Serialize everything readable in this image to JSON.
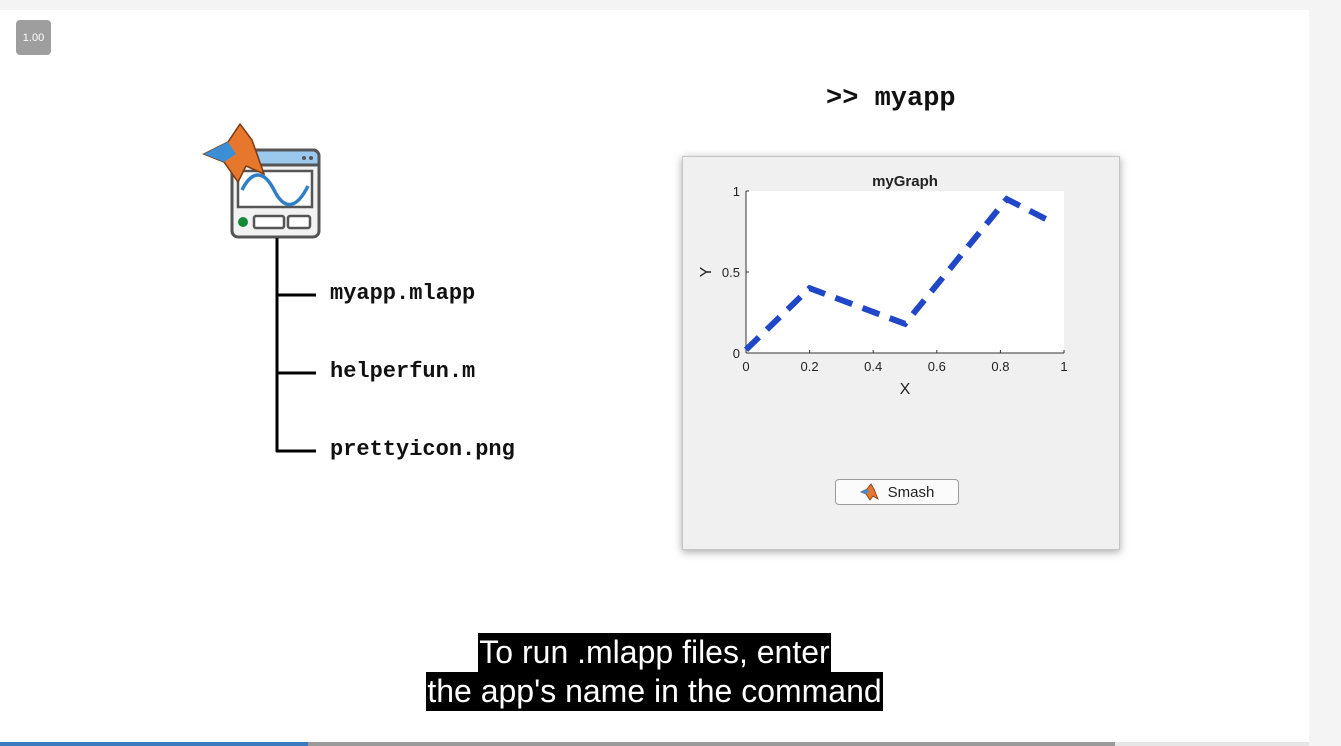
{
  "player": {
    "speed_label": "1.00",
    "progress_fraction": 0.235,
    "buffered_fraction": 0.852
  },
  "slide": {
    "command": ">> myapp",
    "files": [
      "myapp.mlapp",
      "helperfun.m",
      "prettyicon.png"
    ],
    "icons": {
      "app": "matlab-app-icon",
      "button": "matlab-logo-icon"
    },
    "colors": {
      "line": "#1f47c8",
      "matlab_orange": "#e8772e",
      "matlab_blue": "#3c8fd6"
    }
  },
  "figure": {
    "button_label": "Smash"
  },
  "chart_data": {
    "type": "line",
    "title": "myGraph",
    "xlabel": "X",
    "ylabel": "Y",
    "xlim": [
      0,
      1
    ],
    "ylim": [
      0,
      1
    ],
    "xticks": [
      "0",
      "0.2",
      "0.4",
      "0.6",
      "0.8",
      "1"
    ],
    "yticks": [
      "0",
      "0.5",
      "1"
    ],
    "line_style": "dashed",
    "series": [
      {
        "x": [
          0,
          0.2,
          0.5,
          0.82,
          0.95
        ],
        "y": [
          0.02,
          0.4,
          0.18,
          0.95,
          0.82
        ]
      }
    ]
  },
  "caption": {
    "line1": "To run .mlapp files, enter",
    "line2": "the app's name in the command"
  }
}
